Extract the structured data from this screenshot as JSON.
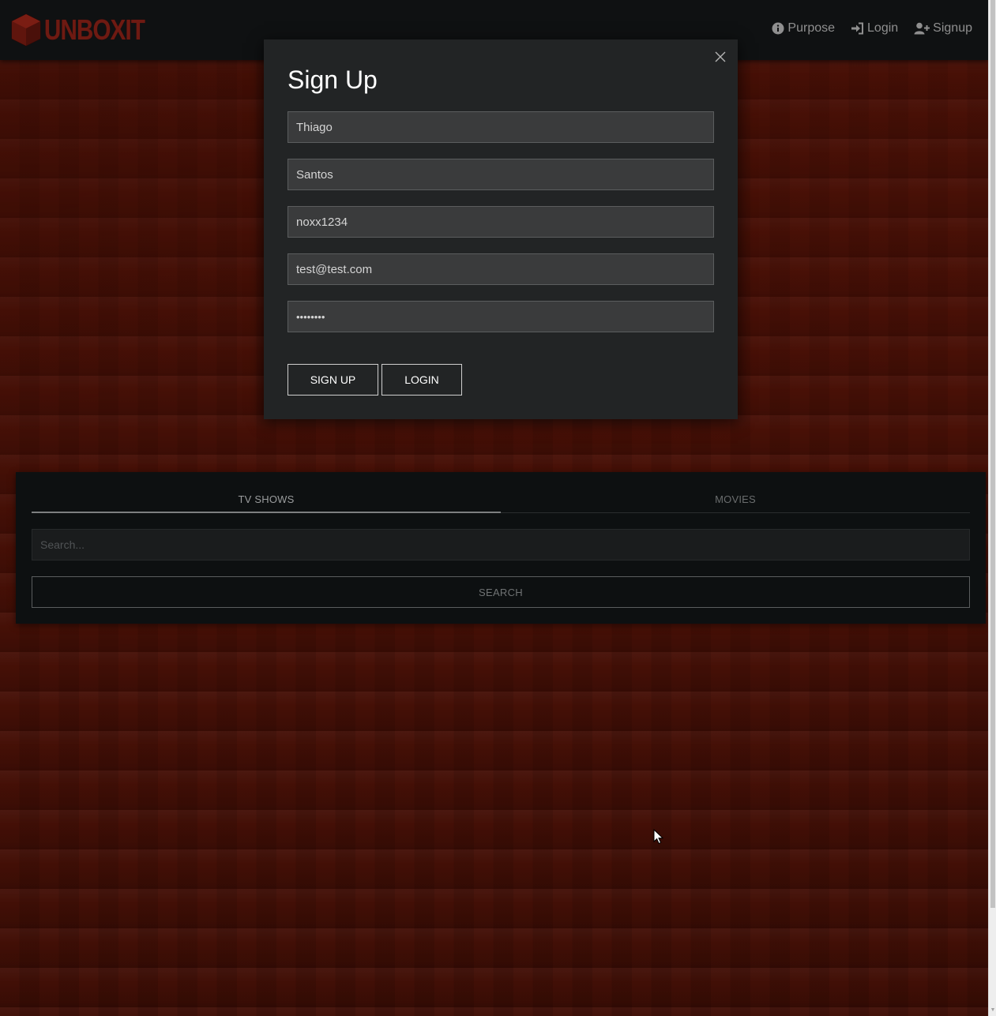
{
  "navbar": {
    "brand": "UNBOXIT",
    "links": [
      {
        "label": "Purpose",
        "icon": "info-circle-icon"
      },
      {
        "label": "Login",
        "icon": "sign-in-icon"
      },
      {
        "label": "Signup",
        "icon": "user-plus-icon"
      }
    ]
  },
  "modal": {
    "title": "Sign Up",
    "fields": {
      "first_name": "Thiago",
      "last_name": "Santos",
      "username": "noxx1234",
      "email": "test@test.com",
      "password": "••••••••"
    },
    "signup_label": "SIGN UP",
    "login_label": "LOGIN"
  },
  "search_panel": {
    "tabs": [
      {
        "label": "TV SHOWS",
        "active": true
      },
      {
        "label": "MOVIES",
        "active": false
      }
    ],
    "search_placeholder": "Search...",
    "search_label": "SEARCH"
  },
  "colors": {
    "brand": "#6e1a12",
    "background": "#3f0f06",
    "navbar": "#0f1112",
    "modal": "#222425"
  }
}
